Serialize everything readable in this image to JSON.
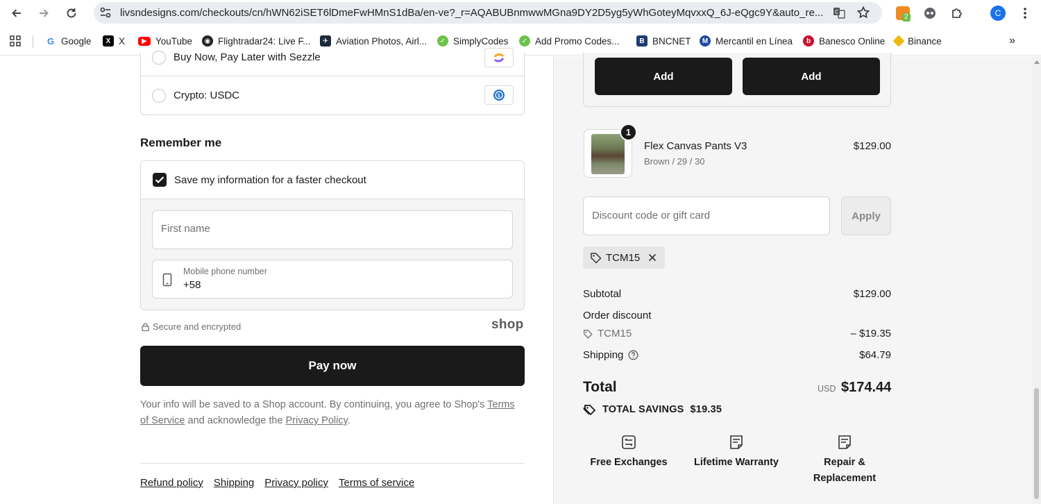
{
  "browser": {
    "url": "livsndesigns.com/checkouts/cn/hWN62iSET6lDmeFwHMnS1dBa/en-ve?_r=AQABUBnmwwMGna9DY2D5yg5yWhGoteyMqvxxQ_6J-eQgc9Y&auto_re...",
    "extension_badge": "2",
    "profile_initial": "C",
    "bookmarks": [
      {
        "label": "Google",
        "icon": "google-icon",
        "color": "#4285f4"
      },
      {
        "label": "X",
        "icon": "x-icon",
        "color": "#000000"
      },
      {
        "label": "YouTube",
        "icon": "youtube-icon",
        "color": "#ff0000"
      },
      {
        "label": "Flightradar24: Live F...",
        "icon": "flightradar-icon",
        "color": "#222222"
      },
      {
        "label": "Aviation Photos, Airl...",
        "icon": "aviation-icon",
        "color": "#1c2a3a"
      },
      {
        "label": "SimplyCodes",
        "icon": "simplycodes-icon",
        "color": "#6cc24a"
      },
      {
        "label": "Add Promo Codes...",
        "icon": "promo-icon",
        "color": "#6cc24a"
      },
      {
        "label": "BNCNET",
        "icon": "bncnet-icon",
        "color": "#1f3b73"
      },
      {
        "label": "Mercantil en Línea",
        "icon": "mercantil-icon",
        "color": "#1b4a9c"
      },
      {
        "label": "Banesco Online",
        "icon": "banesco-icon",
        "color": "#c8102e"
      },
      {
        "label": "Binance",
        "icon": "binance-icon",
        "color": "#f0b90b"
      }
    ]
  },
  "checkout": {
    "payment_methods": [
      {
        "label": "Buy Now, Pay Later with Sezzle"
      },
      {
        "label": "Crypto: USDC"
      }
    ],
    "remember_title": "Remember me",
    "save_info_label": "Save my information for a faster checkout",
    "save_info_checked": true,
    "first_name_placeholder": "First name",
    "phone_label": "Mobile phone number",
    "phone_value": "+58",
    "secure_text": "Secure and encrypted",
    "shop_logo": "shop",
    "pay_now_label": "Pay now",
    "consent": {
      "before": "Your info will be saved to a Shop account. By continuing, you agree to Shop's ",
      "terms_link": "Terms of Service",
      "middle": " and acknowledge the ",
      "privacy_link": "Privacy Policy",
      "after": "."
    },
    "footer_links": [
      "Refund policy",
      "Shipping",
      "Privacy policy",
      "Terms of service"
    ]
  },
  "summary": {
    "add_buttons": [
      "Add",
      "Add"
    ],
    "product": {
      "quantity": "1",
      "name": "Flex Canvas Pants V3",
      "variant": "Brown / 29 / 30",
      "price": "$129.00"
    },
    "discount_placeholder": "Discount code or gift card",
    "apply_label": "Apply",
    "applied_code": "TCM15",
    "subtotal_label": "Subtotal",
    "subtotal_value": "$129.00",
    "order_discount_label": "Order discount",
    "discount_code": "TCM15",
    "discount_value": "– $19.35",
    "shipping_label": "Shipping",
    "shipping_value": "$64.79",
    "total_label": "Total",
    "currency": "USD",
    "total_value": "$174.44",
    "savings_label": "TOTAL SAVINGS",
    "savings_value": "$19.35",
    "features": [
      {
        "label": "Free Exchanges",
        "icon": "exchange-icon"
      },
      {
        "label": "Lifetime Warranty",
        "icon": "warranty-icon"
      },
      {
        "label": "Repair & Replacement",
        "icon": "repair-icon"
      }
    ]
  }
}
